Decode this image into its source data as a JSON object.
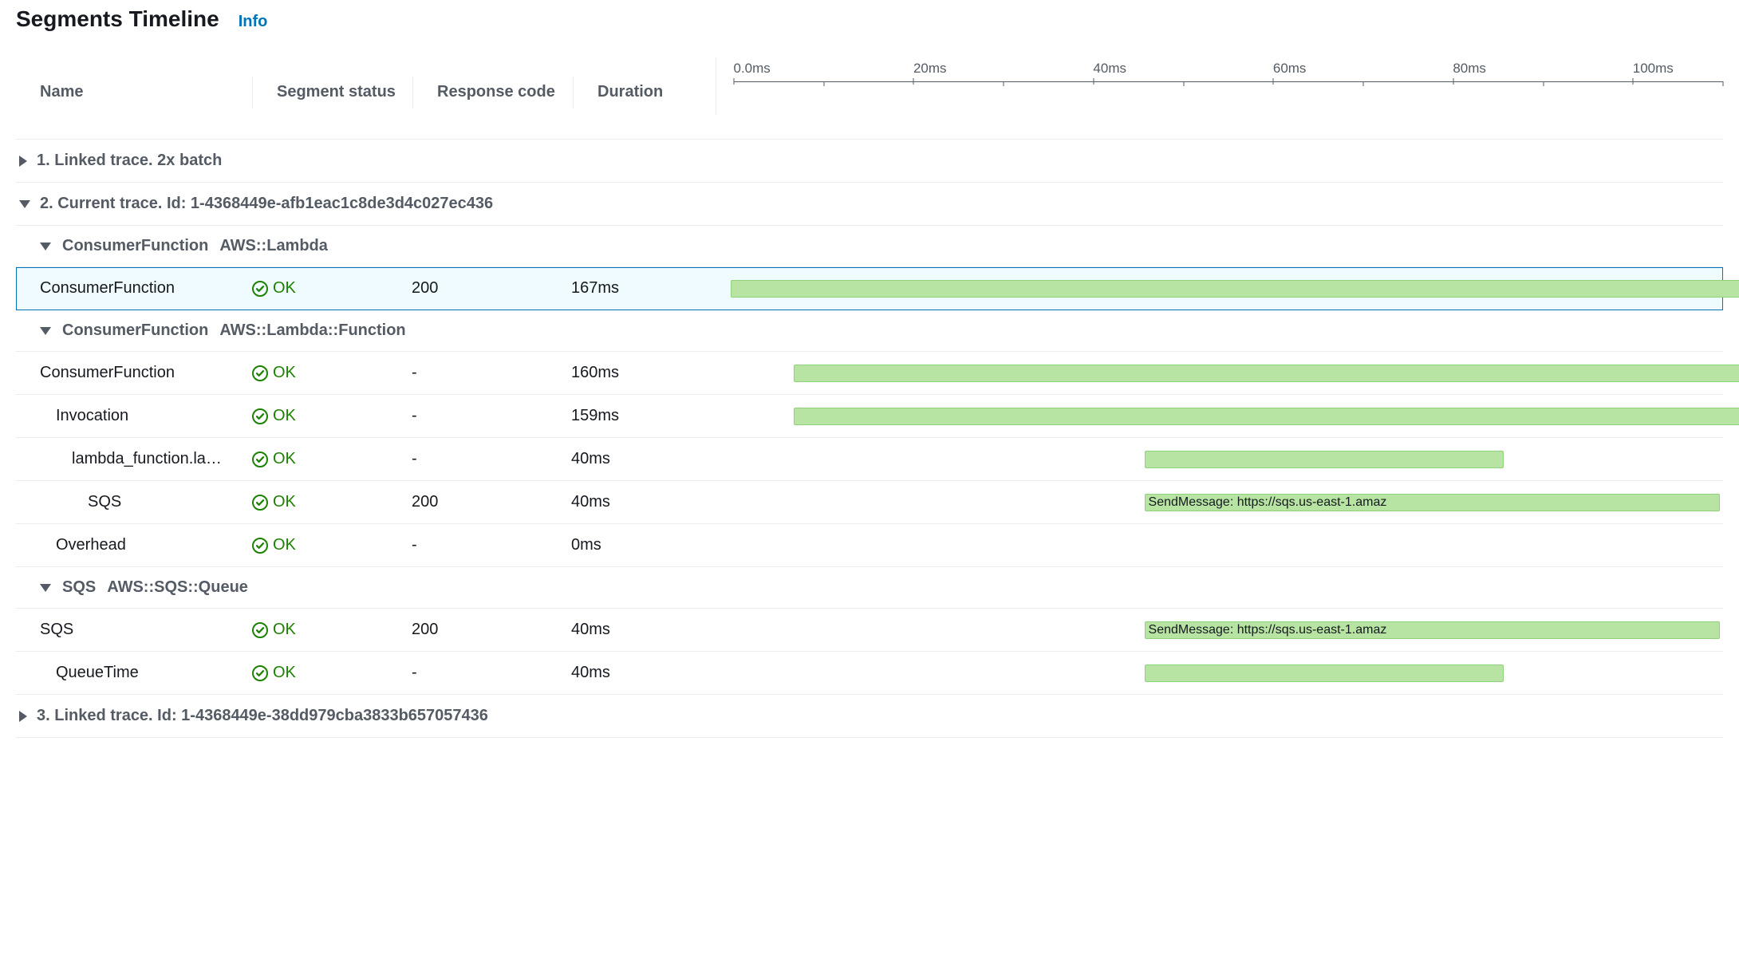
{
  "heading": "Segments Timeline",
  "info_label": "Info",
  "columns": {
    "name": "Name",
    "status": "Segment status",
    "resp": "Response code",
    "dur": "Duration"
  },
  "axis": {
    "ticks": [
      "0.0ms",
      "20ms",
      "40ms",
      "60ms",
      "80ms",
      "100ms"
    ],
    "max_ms": 110,
    "step_ms": 20
  },
  "status_ok": "OK",
  "traces": [
    {
      "expanded": false,
      "label": "1. Linked trace. 2x batch"
    },
    {
      "expanded": true,
      "label": "2. Current trace. Id: 1-4368449e-afb1eac1c8de3d4c027ec436",
      "groups": [
        {
          "name": "ConsumerFunction",
          "type": "AWS::Lambda",
          "expanded": true,
          "rows": [
            {
              "name": "ConsumerFunction",
              "status": "OK",
              "resp": "200",
              "dur": "167ms",
              "bar_start_ms": 0,
              "bar_len_ms": 167,
              "selected": true,
              "indent": 0,
              "bar_label": ""
            }
          ]
        },
        {
          "name": "ConsumerFunction",
          "type": "AWS::Lambda::Function",
          "expanded": true,
          "rows": [
            {
              "name": "ConsumerFunction",
              "status": "OK",
              "resp": "-",
              "dur": "160ms",
              "bar_start_ms": 7,
              "bar_len_ms": 160,
              "indent": 0,
              "bar_label": ""
            },
            {
              "name": "Invocation",
              "status": "OK",
              "resp": "-",
              "dur": "159ms",
              "bar_start_ms": 7,
              "bar_len_ms": 159,
              "indent": 1,
              "bar_label": ""
            },
            {
              "name": "lambda_function.la…",
              "status": "OK",
              "resp": "-",
              "dur": "40ms",
              "bar_start_ms": 46,
              "bar_len_ms": 40,
              "indent": 2,
              "bar_label": ""
            },
            {
              "name": "SQS",
              "status": "OK",
              "resp": "200",
              "dur": "40ms",
              "bar_start_ms": 46,
              "bar_len_ms": 64,
              "indent": 3,
              "bar_label": "SendMessage: https://sqs.us-east-1.amaz"
            },
            {
              "name": "Overhead",
              "status": "OK",
              "resp": "-",
              "dur": "0ms",
              "bar_start_ms": 167,
              "bar_len_ms": 0,
              "indent": 1,
              "bar_label": ""
            }
          ]
        },
        {
          "name": "SQS",
          "type": "AWS::SQS::Queue",
          "expanded": true,
          "rows": [
            {
              "name": "SQS",
              "status": "OK",
              "resp": "200",
              "dur": "40ms",
              "bar_start_ms": 46,
              "bar_len_ms": 64,
              "indent": 0,
              "bar_label": "SendMessage: https://sqs.us-east-1.amaz"
            },
            {
              "name": "QueueTime",
              "status": "OK",
              "resp": "-",
              "dur": "40ms",
              "bar_start_ms": 46,
              "bar_len_ms": 40,
              "indent": 1,
              "bar_label": ""
            }
          ]
        }
      ]
    },
    {
      "expanded": false,
      "label": "3. Linked trace. Id: 1-4368449e-38dd979cba3833b657057436"
    }
  ]
}
